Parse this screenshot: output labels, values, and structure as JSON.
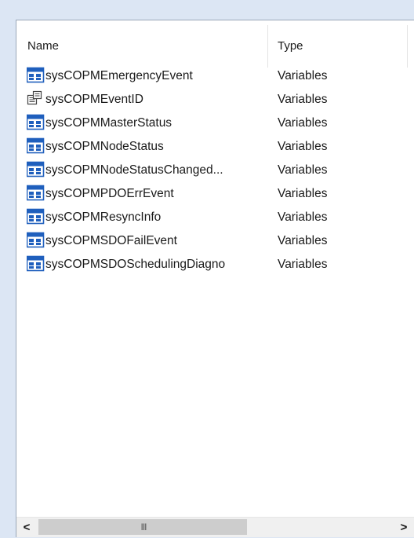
{
  "columns": {
    "name": "Name",
    "type": "Type"
  },
  "rows": [
    {
      "icon": "struct-variable-icon",
      "name": "sysCOPMEmergencyEvent",
      "type": "Variables"
    },
    {
      "icon": "enum-id-icon",
      "name": "sysCOPMEventID",
      "type": "Variables"
    },
    {
      "icon": "struct-variable-icon",
      "name": "sysCOPMMasterStatus",
      "type": "Variables"
    },
    {
      "icon": "struct-variable-icon",
      "name": "sysCOPMNodeStatus",
      "type": "Variables"
    },
    {
      "icon": "struct-variable-icon",
      "name": "sysCOPMNodeStatusChanged...",
      "type": "Variables"
    },
    {
      "icon": "struct-variable-icon",
      "name": "sysCOPMPDOErrEvent",
      "type": "Variables"
    },
    {
      "icon": "struct-variable-icon",
      "name": "sysCOPMResyncInfo",
      "type": "Variables"
    },
    {
      "icon": "struct-variable-icon",
      "name": "sysCOPMSDOFailEvent",
      "type": "Variables"
    },
    {
      "icon": "struct-variable-icon",
      "name": "sysCOPMSDOSchedulingDiagno",
      "type": "Variables"
    }
  ],
  "scrollbar": {
    "left_arrow": "<",
    "right_arrow": ">",
    "grip": "III"
  },
  "colors": {
    "icon_blue": "#1f5fbd",
    "background": "#dce6f4"
  }
}
